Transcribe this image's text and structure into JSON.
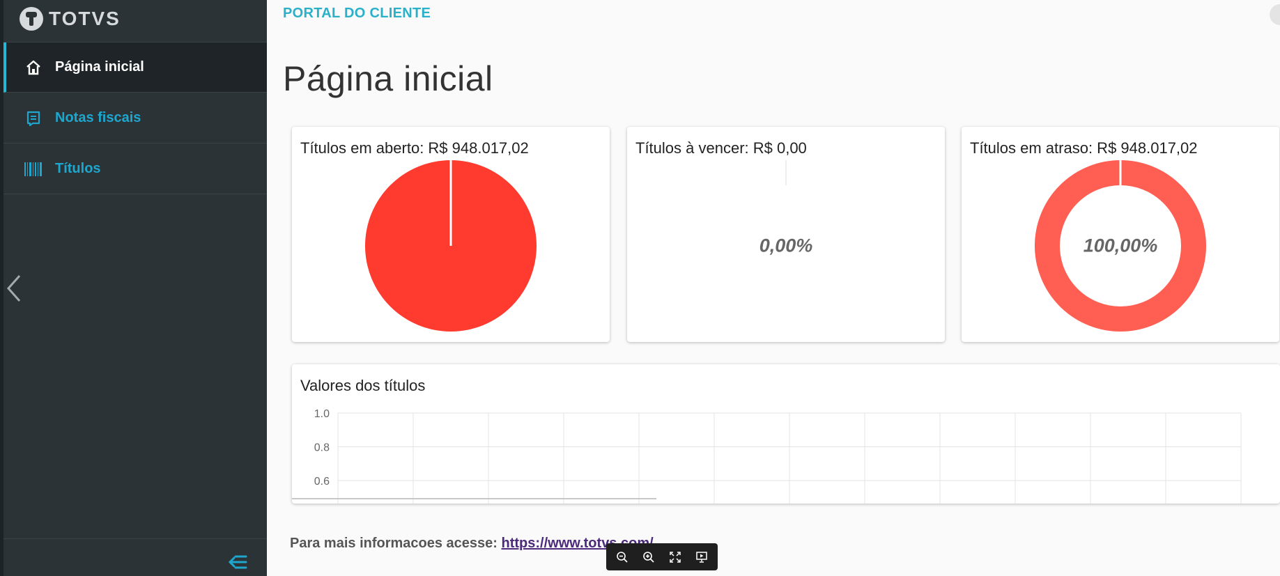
{
  "brand": {
    "name": "TOTVS"
  },
  "header": {
    "portal_title": "PORTAL DO CLIENTE"
  },
  "main": {
    "page_title": "Página inicial"
  },
  "sidebar": {
    "items": [
      {
        "label": "Página inicial",
        "icon": "home-icon",
        "active": true
      },
      {
        "label": "Notas fiscais",
        "icon": "invoice-icon",
        "active": false
      },
      {
        "label": "Títulos",
        "icon": "barcode-icon",
        "active": false
      }
    ]
  },
  "cards": [
    {
      "title": "Títulos em aberto: R$ 948.017,02",
      "percent_label": "",
      "chart": "pie"
    },
    {
      "title": "Títulos à vencer: R$ 0,00",
      "percent_label": "0,00%",
      "chart": "donut-empty"
    },
    {
      "title": "Títulos em atraso: R$ 948.017,02",
      "percent_label": "100,00%",
      "chart": "donut"
    }
  ],
  "bar_section": {
    "title": "Valores dos títulos"
  },
  "footer": {
    "text": "Para mais informacoes acesse:",
    "link": "https://www.totvs.com/"
  },
  "viewer_toolbar": [
    "zoom-out-icon",
    "zoom-in-icon",
    "fullscreen-icon",
    "presentation-icon"
  ],
  "colors": {
    "accent": "#25b7d3",
    "pie_red": "#ff3a2f",
    "donut_red": "#ff5e52",
    "sidebar_bg": "#2c3337"
  },
  "chart_data": [
    {
      "type": "pie",
      "title": "Títulos em aberto: R$ 948.017,02",
      "values": [
        100
      ]
    },
    {
      "type": "pie",
      "title": "Títulos à vencer: R$ 0,00",
      "values": [
        0
      ],
      "center_label": "0,00%"
    },
    {
      "type": "pie",
      "title": "Títulos em atraso: R$ 948.017,02",
      "values": [
        100
      ],
      "center_label": "100,00%"
    },
    {
      "type": "bar",
      "title": "Valores dos títulos",
      "y_ticks": [
        "1.0",
        "0.8",
        "0.6"
      ],
      "ylim": [
        0.6,
        1.0
      ],
      "values": [],
      "grid": true
    }
  ]
}
